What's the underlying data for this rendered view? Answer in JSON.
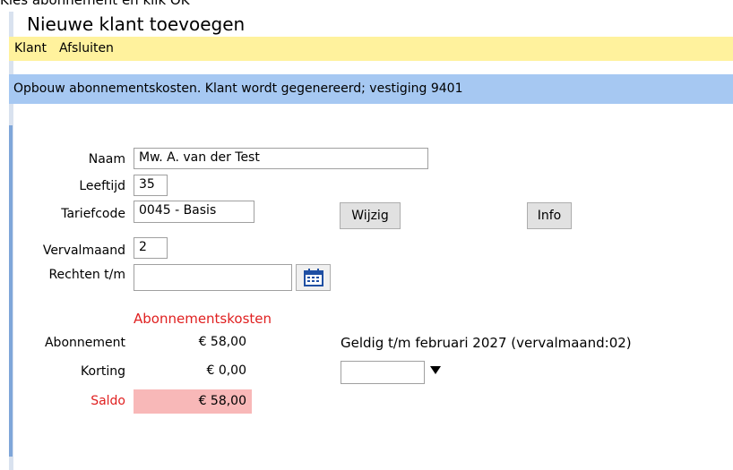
{
  "instruction": "Kies abonnement en klik OK",
  "window": {
    "title": "Nieuwe klant toevoegen"
  },
  "menu": {
    "items": [
      "Klant",
      "Afsluiten"
    ]
  },
  "status": {
    "text": "Opbouw abonnementskosten. Klant wordt gegenereerd; vestiging 9401"
  },
  "form": {
    "naam_label": "Naam",
    "naam_value": "Mw.  A. van der Test",
    "leeftijd_label": "Leeftijd",
    "leeftijd_value": "35",
    "tariefcode_label": "Tariefcode",
    "tariefcode_value": "0045 - Basis",
    "vervalmaand_label": "Vervalmaand",
    "vervalmaand_value": "2",
    "rechten_label": "Rechten t/m",
    "rechten_value": ""
  },
  "buttons": {
    "wijzig": "Wijzig",
    "info": "Info"
  },
  "costs": {
    "heading": "Abonnementskosten",
    "abonnement_label": "Abonnement",
    "abonnement_value": "€ 58,00",
    "korting_label": "Korting",
    "korting_value": "€ 0,00",
    "saldo_label": "Saldo",
    "saldo_value": "€ 58,00",
    "geldig_text": "Geldig t/m februari 2027 (vervalmaand:02)",
    "dropdown_value": ""
  },
  "colors": {
    "menubar": "#fff29d",
    "band": "#a6c8f2",
    "saldo_bg": "#f8b8b8",
    "red_text": "#e02020"
  },
  "icons": {
    "calendar": "calendar-icon",
    "dropdown": "chevron-down-icon"
  }
}
